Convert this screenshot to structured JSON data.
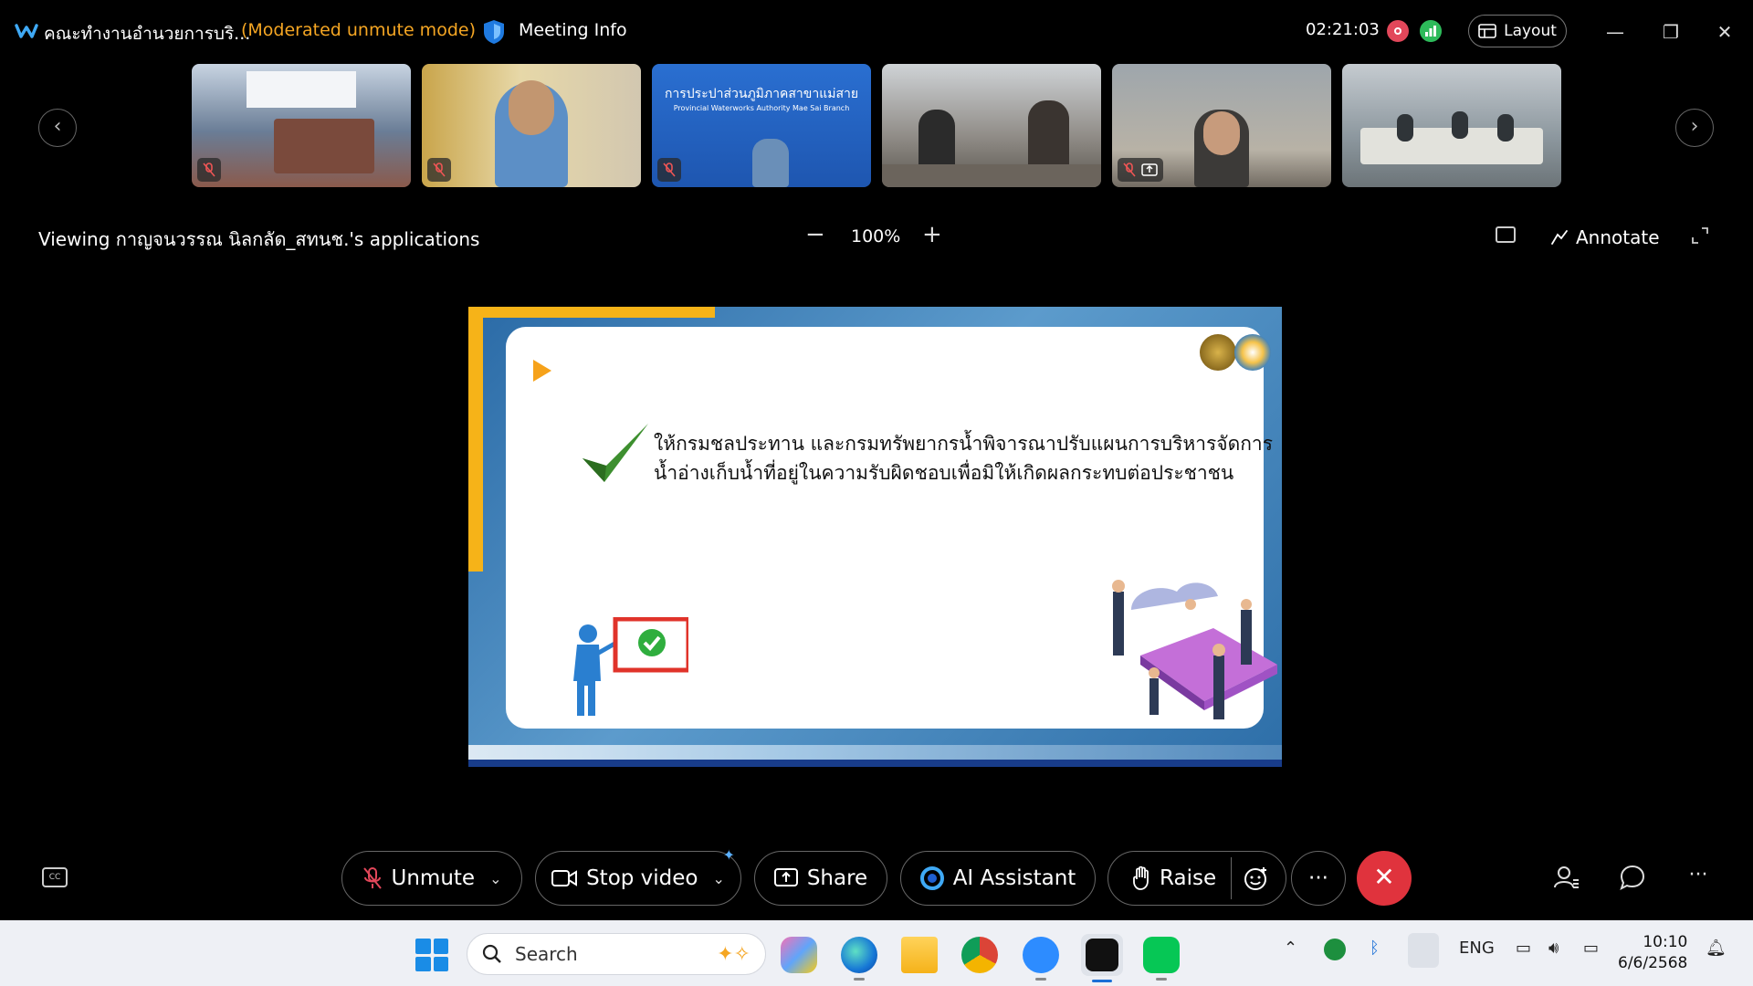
{
  "titlebar": {
    "meeting_title": "คณะทำงานอำนวยการบริ...",
    "mode": "(Moderated unmute mode)",
    "meeting_info": "Meeting Info",
    "timer": "02:21:03",
    "layout_label": "Layout"
  },
  "share": {
    "viewing": "Viewing กาญจนวรรณ นิลกลัด_สทนช.'s applications",
    "zoom": "100%",
    "zoom_minus": "−",
    "zoom_plus": "+",
    "annotate": "Annotate"
  },
  "slide": {
    "text": "ให้กรมชลประทาน และกรมทรัพยากรน้ำพิจารณาปรับแผนการบริหารจัดการน้ำอ่างเก็บน้ำที่อยู่ในความรับผิดชอบเพื่อมิให้เกิดผลกระทบต่อประชาชน"
  },
  "thumbnails": [
    {
      "name": "participant-1",
      "bg": "#5d6f86"
    },
    {
      "name": "participant-2",
      "bg": "#bfa06a"
    },
    {
      "name": "participant-3",
      "bg": "#2a66c4",
      "caption_th": "การประปาส่วนภูมิภาคสาขาแม่สาย",
      "caption_en": "Provincial Waterworks Authority Mae Sai Branch"
    },
    {
      "name": "participant-4",
      "bg": "#8d8a86"
    },
    {
      "name": "participant-5",
      "bg": "#a0a4a8"
    },
    {
      "name": "participant-6",
      "bg": "#8e9ca8"
    }
  ],
  "controls": {
    "unmute": "Unmute",
    "stop_video": "Stop video",
    "share": "Share",
    "ai_assistant": "AI Assistant",
    "raise": "Raise",
    "more": "···"
  },
  "taskbar": {
    "search": "Search",
    "lang": "ENG",
    "time": "10:10",
    "date": "6/6/2568"
  },
  "colors": {
    "accent_orange": "#f5a623",
    "end_call": "#e0333d",
    "muted_red": "#e2475a"
  }
}
